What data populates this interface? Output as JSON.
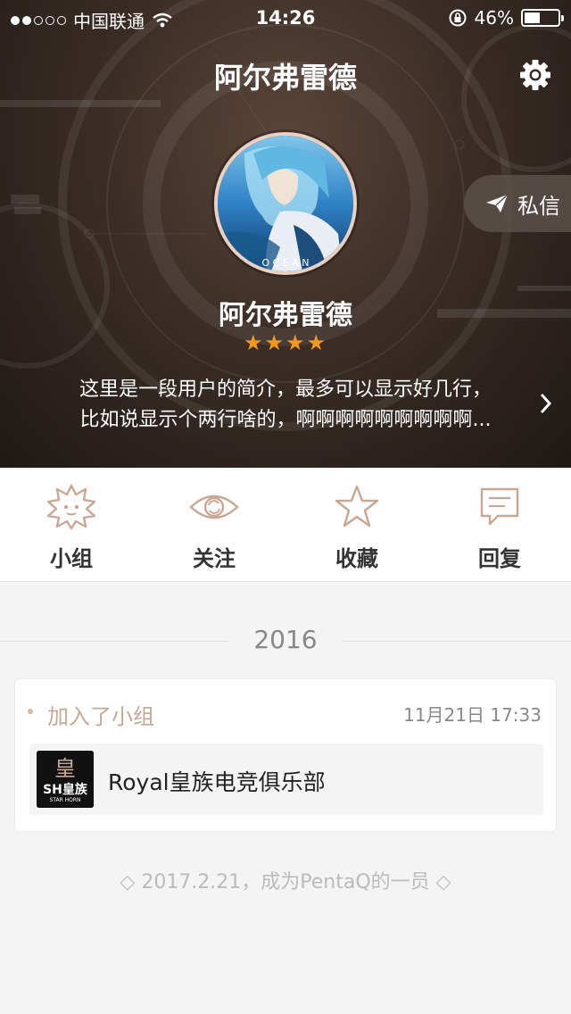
{
  "status_bar": {
    "carrier": "中国联通",
    "time": "14:26",
    "battery_text": "46%",
    "battery_level": 0.46,
    "signal_strength": 2
  },
  "header": {
    "title": "阿尔弗雷德",
    "settings_icon": "gear-icon"
  },
  "profile": {
    "avatar_caption": "O C E A N",
    "name": "阿尔弗雷德",
    "stars": "★★★★",
    "rating": 4,
    "bio_line1": "这里是一段用户的简介，最多可以显示好几行，",
    "bio_line2": "比如说显示个两行啥的，啊啊啊啊啊啊啊啊啊...",
    "message_button": "私信"
  },
  "tabs": [
    {
      "label": "小组",
      "icon": "group-face-icon"
    },
    {
      "label": "关注",
      "icon": "eye-icon"
    },
    {
      "label": "收藏",
      "icon": "star-icon"
    },
    {
      "label": "回复",
      "icon": "comment-icon"
    }
  ],
  "timeline": {
    "year": "2016",
    "activity": {
      "action": "加入了小组",
      "datetime": "11月21日 17:33",
      "group_name": "Royal皇族电竞俱乐部",
      "logo_top": "皇",
      "logo_main": "SH皇族",
      "logo_sub": "STAR HORN"
    },
    "footer_note": "◇ 2017.2.21，成为PentaQ的一员 ◇"
  },
  "colors": {
    "accent_brown": "#c9a792",
    "star_orange": "#f29a1f",
    "hero_dark": "#2a211d"
  }
}
